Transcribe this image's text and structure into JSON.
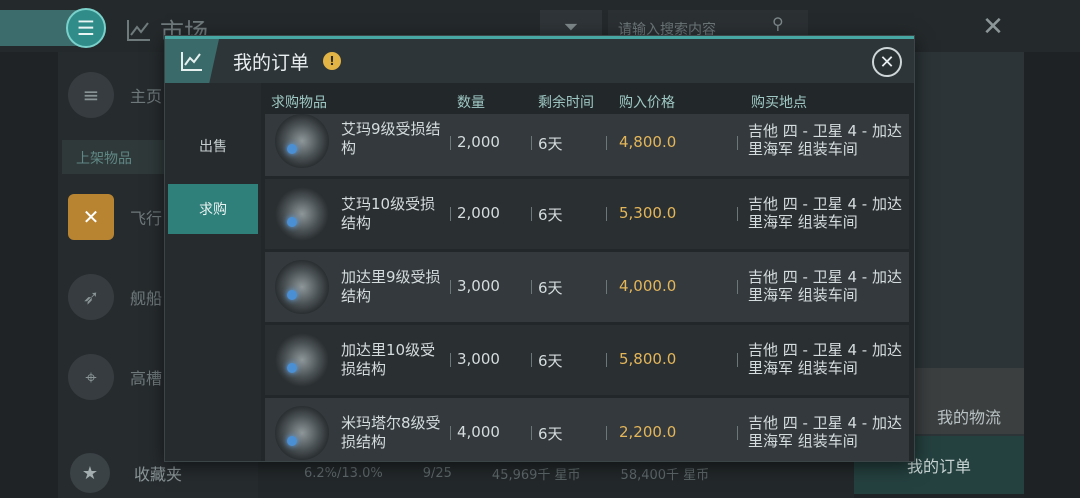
{
  "background": {
    "title": "市场",
    "search_placeholder": "请输入搜索内容",
    "sidebar_home": "主页",
    "sidebar_header": "上架物品",
    "sidebar_items": [
      "飞行",
      "舰船",
      "高槽"
    ],
    "favorites": "收藏夹",
    "bottom_stats": [
      "6.2%/13.0%",
      "9/25",
      "45,969千 星币",
      "58,400千 星币"
    ],
    "my_logistics": "我的物流",
    "my_orders": "我的订单"
  },
  "modal": {
    "title": "我的订单",
    "tabs": [
      {
        "label": "出售",
        "active": false
      },
      {
        "label": "求购",
        "active": true
      }
    ],
    "columns": {
      "item": "求购物品",
      "qty": "数量",
      "time": "剩余时间",
      "price": "购入价格",
      "location": "购买地点"
    },
    "rows": [
      {
        "name": "艾玛9级受损结构",
        "qty": "2,000",
        "time": "6天",
        "price": "4,800.0",
        "location": "吉他 四 - 卫星 4 - 加达里海军 组装车间"
      },
      {
        "name": "艾玛10级受损结构",
        "qty": "2,000",
        "time": "6天",
        "price": "5,300.0",
        "location": "吉他 四 - 卫星 4 - 加达里海军 组装车间"
      },
      {
        "name": "加达里9级受损结构",
        "qty": "3,000",
        "time": "6天",
        "price": "4,000.0",
        "location": "吉他 四 - 卫星 4 - 加达里海军 组装车间"
      },
      {
        "name": "加达里10级受损结构",
        "qty": "3,000",
        "time": "6天",
        "price": "5,800.0",
        "location": "吉他 四 - 卫星 4 - 加达里海军 组装车间"
      },
      {
        "name": "米玛塔尔8级受损结构",
        "qty": "4,000",
        "time": "6天",
        "price": "2,200.0",
        "location": "吉他 四 - 卫星 4 - 加达里海军 组装车间"
      }
    ]
  },
  "colors": {
    "accent": "#2f7f7b",
    "price": "#e4b65a",
    "alert": "#e2b446"
  }
}
